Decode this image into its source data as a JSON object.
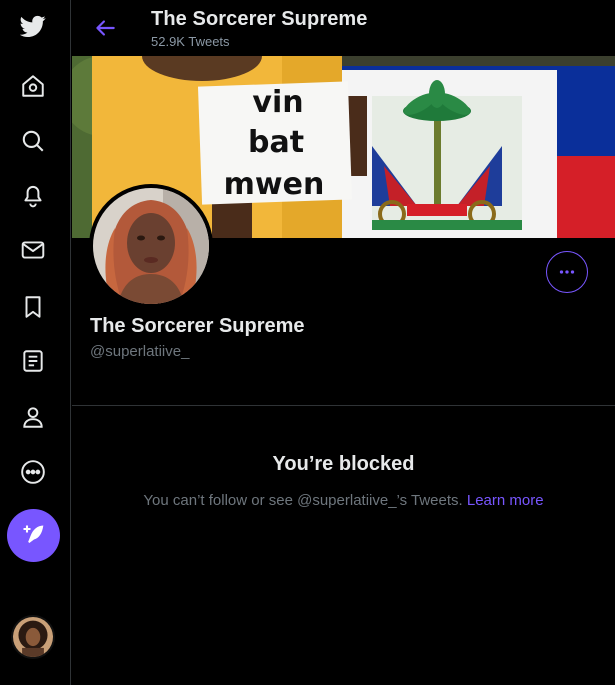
{
  "colors": {
    "accent": "#7856ff",
    "background": "#000000",
    "text": "#e7e9ea",
    "muted": "#6e767d"
  },
  "sidebar": {
    "items": [
      {
        "icon": "twitter-logo-icon"
      },
      {
        "icon": "home-icon"
      },
      {
        "icon": "explore-search-icon"
      },
      {
        "icon": "notifications-bell-icon"
      },
      {
        "icon": "messages-mail-icon"
      },
      {
        "icon": "bookmarks-icon"
      },
      {
        "icon": "lists-icon"
      },
      {
        "icon": "profile-icon"
      },
      {
        "icon": "more-icon"
      }
    ],
    "compose_icon": "compose-tweet-icon"
  },
  "header": {
    "title": "The Sorcerer Supreme",
    "tweet_count": "52.9K Tweets"
  },
  "banner": {
    "sign_lines": [
      "vin",
      "bat",
      "mwen"
    ]
  },
  "profile": {
    "name": "The Sorcerer Supreme",
    "handle": "@superlatiive_"
  },
  "blocked": {
    "title": "You’re blocked",
    "message": "You can’t follow or see @superlatiive_’s Tweets.",
    "link": "Learn more"
  }
}
